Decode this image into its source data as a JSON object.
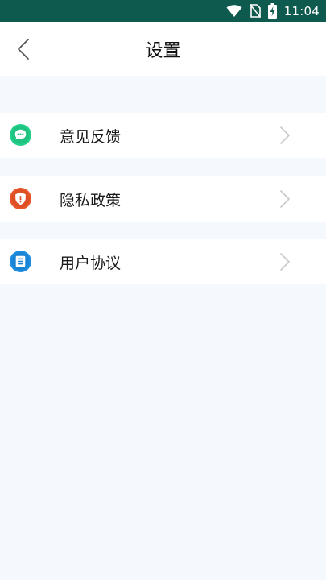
{
  "status_bar": {
    "time": "11:04",
    "icons": [
      "wifi-icon",
      "no-sim-icon",
      "battery-charging-icon"
    ],
    "background": "#0e5a4e"
  },
  "header": {
    "title": "设置",
    "back_icon": "chevron-left-icon"
  },
  "menu": {
    "items": [
      {
        "label": "意见反馈",
        "icon": "feedback-chat-icon",
        "icon_color": "#23d08a"
      },
      {
        "label": "隐私政策",
        "icon": "privacy-shield-icon",
        "icon_color": "#e8572a"
      },
      {
        "label": "用户协议",
        "icon": "user-agreement-icon",
        "icon_color": "#1e8fe0"
      }
    ],
    "chevron_icon": "chevron-right-icon"
  },
  "colors": {
    "page_background": "#f5f9fd",
    "row_background": "#ffffff"
  }
}
